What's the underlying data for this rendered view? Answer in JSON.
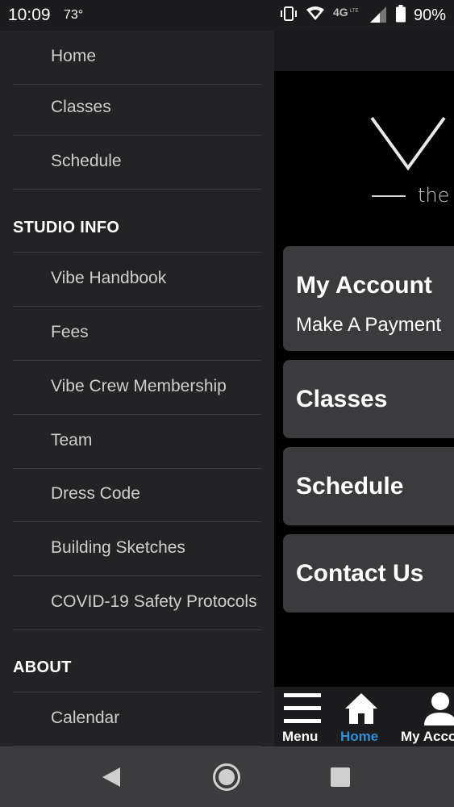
{
  "status_bar": {
    "time": "10:09",
    "temperature": "73°",
    "battery": "90%",
    "icons": [
      "vibrate-icon",
      "wifi-icon",
      "4g-lte-icon",
      "cell-signal-icon",
      "battery-icon"
    ]
  },
  "drawer": {
    "top_items": [
      {
        "label": "Home"
      },
      {
        "label": "Classes"
      },
      {
        "label": "Schedule"
      }
    ],
    "studio_info_heading": "STUDIO INFO",
    "studio_info_items": [
      {
        "label": "Vibe Handbook"
      },
      {
        "label": "Fees"
      },
      {
        "label": "Vibe Crew Membership"
      },
      {
        "label": "Team"
      },
      {
        "label": "Dress Code"
      },
      {
        "label": "Building Sketches"
      },
      {
        "label": "COVID-19 Safety Protocols"
      }
    ],
    "about_heading": "ABOUT",
    "about_items": [
      {
        "label": "Calendar"
      }
    ]
  },
  "main": {
    "logo_tagline": "the",
    "tiles": [
      {
        "title": "My Account",
        "subtitle": "Make A Payment"
      },
      {
        "title": "Classes"
      },
      {
        "title": "Schedule"
      },
      {
        "title": "Contact Us"
      }
    ]
  },
  "bottom_nav": {
    "items": [
      {
        "label": "Menu",
        "icon": "hamburger-icon"
      },
      {
        "label": "Home",
        "icon": "home-icon",
        "active": true
      },
      {
        "label": "My Account",
        "icon": "person-icon"
      }
    ],
    "active_color": "#2f8fd8"
  },
  "android_nav": {
    "icons": [
      "back-icon",
      "home-circle-icon",
      "recents-icon"
    ]
  }
}
